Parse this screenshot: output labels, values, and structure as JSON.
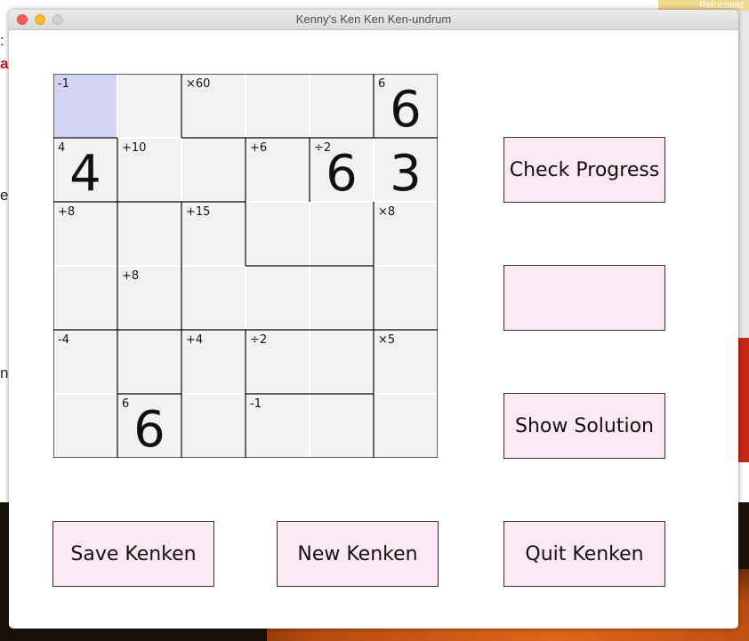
{
  "window": {
    "title": "Kenny's Ken Ken Ken-undrum"
  },
  "background": {
    "relocated_text": "Relocated",
    "left_chars": [
      ":",
      "a",
      "e",
      "n"
    ]
  },
  "grid": {
    "size": 6,
    "cells": [
      [
        {
          "clue": "-1",
          "value": ""
        },
        {
          "clue": "",
          "value": ""
        },
        {
          "clue": "×60",
          "value": ""
        },
        {
          "clue": "",
          "value": ""
        },
        {
          "clue": "",
          "value": ""
        },
        {
          "clue": "6",
          "value": "6"
        }
      ],
      [
        {
          "clue": "4",
          "value": "4"
        },
        {
          "clue": "+10",
          "value": ""
        },
        {
          "clue": "",
          "value": ""
        },
        {
          "clue": "+6",
          "value": ""
        },
        {
          "clue": "÷2",
          "value": "6"
        },
        {
          "clue": "",
          "value": "3"
        }
      ],
      [
        {
          "clue": "+8",
          "value": ""
        },
        {
          "clue": "",
          "value": ""
        },
        {
          "clue": "+15",
          "value": ""
        },
        {
          "clue": "",
          "value": ""
        },
        {
          "clue": "",
          "value": ""
        },
        {
          "clue": "×8",
          "value": ""
        }
      ],
      [
        {
          "clue": "",
          "value": ""
        },
        {
          "clue": "+8",
          "value": ""
        },
        {
          "clue": "",
          "value": ""
        },
        {
          "clue": "",
          "value": ""
        },
        {
          "clue": "",
          "value": ""
        },
        {
          "clue": "",
          "value": ""
        }
      ],
      [
        {
          "clue": "-4",
          "value": ""
        },
        {
          "clue": "",
          "value": ""
        },
        {
          "clue": "+4",
          "value": ""
        },
        {
          "clue": "÷2",
          "value": ""
        },
        {
          "clue": "",
          "value": ""
        },
        {
          "clue": "×5",
          "value": ""
        }
      ],
      [
        {
          "clue": "",
          "value": ""
        },
        {
          "clue": "6",
          "value": "6"
        },
        {
          "clue": "",
          "value": ""
        },
        {
          "clue": "-1",
          "value": ""
        },
        {
          "clue": "",
          "value": ""
        },
        {
          "clue": "",
          "value": ""
        }
      ]
    ],
    "selected": [
      0,
      0
    ]
  },
  "buttons": {
    "check_progress": "Check Progress",
    "blank": "",
    "show_solution": "Show Solution",
    "save": "Save Kenken",
    "new": "New Kenken",
    "quit": "Quit Kenken"
  },
  "colors": {
    "button_bg": "#fde9f3",
    "cell_bg": "#f2f2f2",
    "selected_bg": "#d3d3f6"
  }
}
